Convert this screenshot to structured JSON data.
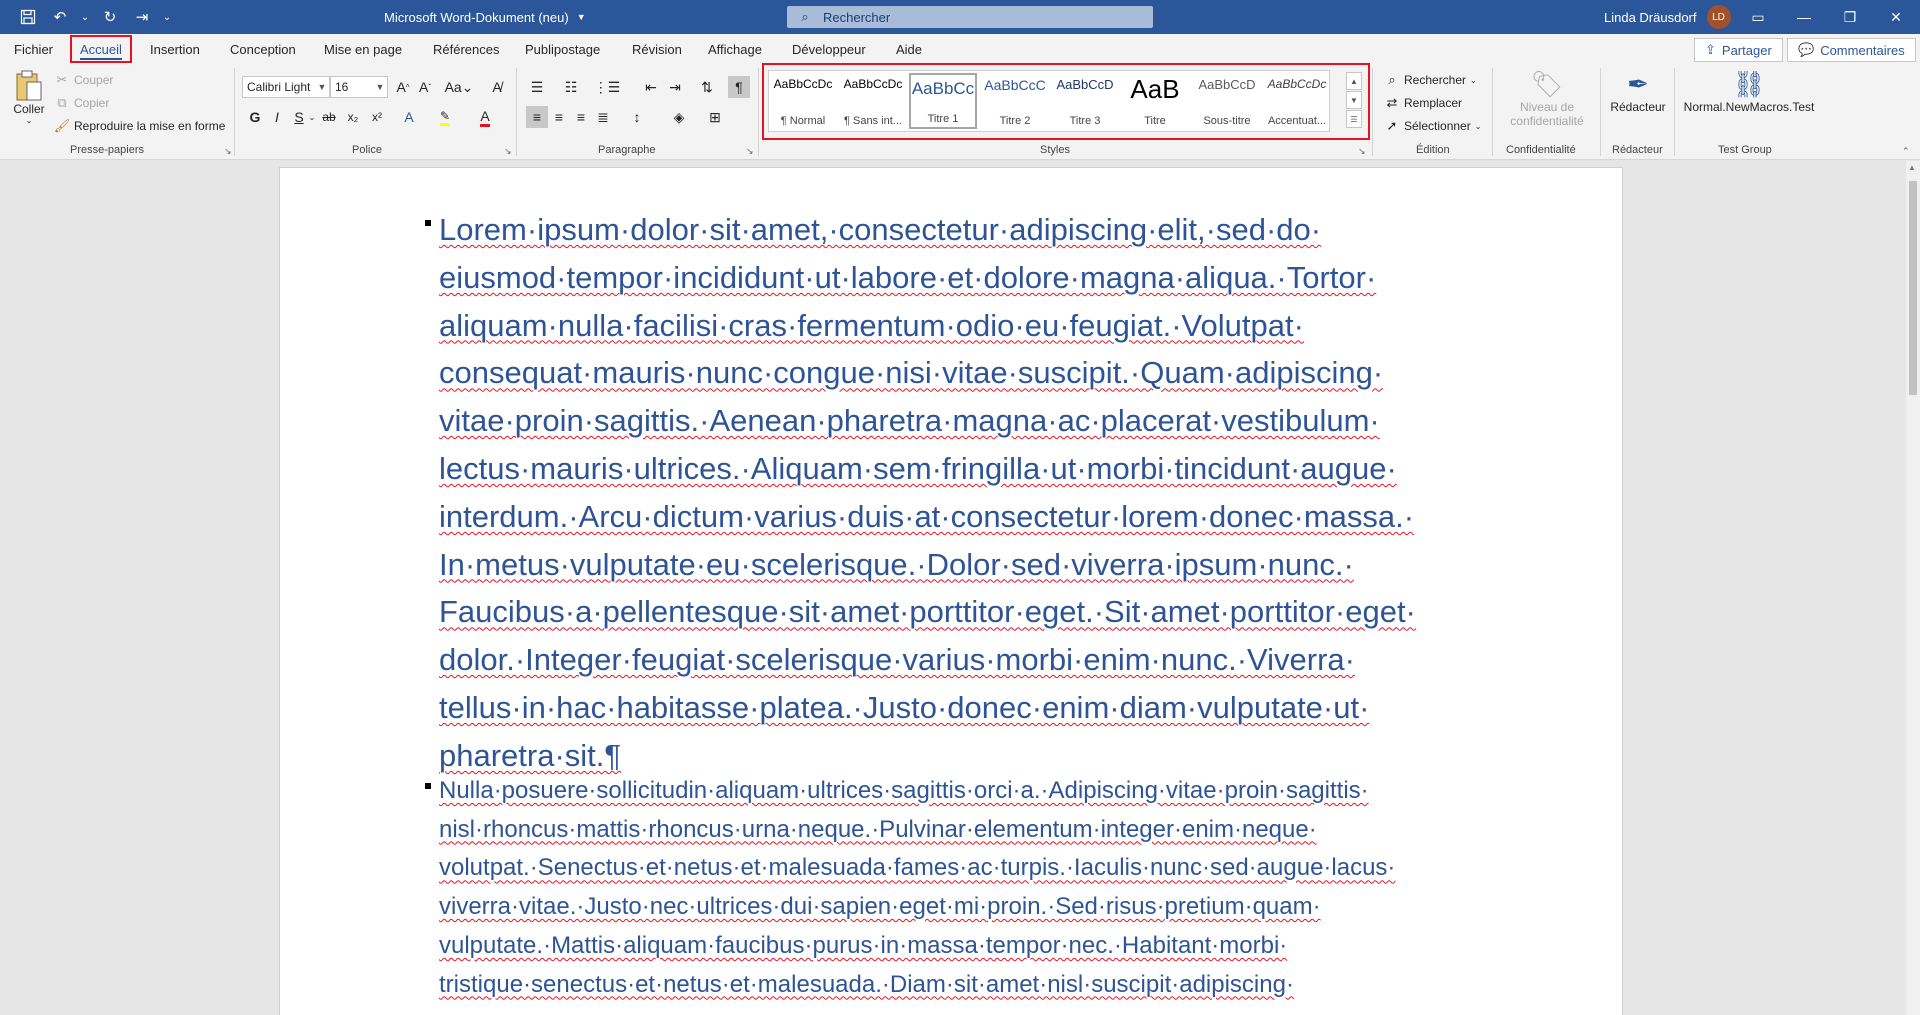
{
  "titlebar": {
    "doc_title": "Microsoft Word-Dokument (neu)",
    "search_placeholder": "Rechercher",
    "user_name": "Linda Dräusdorf",
    "user_initials": "LD"
  },
  "tabs": [
    "Fichier",
    "Accueil",
    "Insertion",
    "Conception",
    "Mise en page",
    "Références",
    "Publipostage",
    "Révision",
    "Affichage",
    "Développeur",
    "Aide"
  ],
  "active_tab": "Accueil",
  "share": {
    "partager": "Partager",
    "commentaires": "Commentaires"
  },
  "clipboard": {
    "label": "Presse-papiers",
    "coller": "Coller",
    "couper": "Couper",
    "copier": "Copier",
    "reproduire": "Reproduire la mise en forme"
  },
  "font": {
    "label": "Police",
    "family": "Calibri Light",
    "size": "16"
  },
  "paragraph": {
    "label": "Paragraphe"
  },
  "styles": {
    "label": "Styles",
    "items": [
      {
        "preview": "AaBbCcDc",
        "name": "¶ Normal"
      },
      {
        "preview": "AaBbCcDc",
        "name": "¶ Sans int..."
      },
      {
        "preview": "AaBbCc",
        "name": "Titre 1"
      },
      {
        "preview": "AaBbCcC",
        "name": "Titre 2"
      },
      {
        "preview": "AaBbCcD",
        "name": "Titre 3"
      },
      {
        "preview": "AaB",
        "name": "Titre"
      },
      {
        "preview": "AaBbCcD",
        "name": "Sous-titre"
      },
      {
        "preview": "AaBbCcDc",
        "name": "Accentuat..."
      }
    ],
    "selected_index": 2
  },
  "edition": {
    "label": "Édition",
    "rechercher": "Rechercher",
    "remplacer": "Remplacer",
    "selectionner": "Sélectionner"
  },
  "confidentialite": {
    "label": "Confidentialité",
    "niveau_line1": "Niveau de",
    "niveau_line2": "confidentialité"
  },
  "redacteur": {
    "label": "Rédacteur",
    "button": "Rédacteur"
  },
  "testgroup": {
    "label": "Test Group",
    "button": "Normal.NewMacros.Test"
  },
  "document": {
    "para1": "Lorem·ipsum·dolor·sit·amet,·consectetur·adipiscing·elit,·sed·do· eiusmod·tempor·incididunt·ut·labore·et·dolore·magna·aliqua.·Tortor· aliquam·nulla·facilisi·cras·fermentum·odio·eu·feugiat.·Volutpat· consequat·mauris·nunc·congue·nisi·vitae·suscipit.·Quam·adipiscing· vitae·proin·sagittis.·Aenean·pharetra·magna·ac·placerat·vestibulum· lectus·mauris·ultrices.·Aliquam·sem·fringilla·ut·morbi·tincidunt·augue· interdum.·Arcu·dictum·varius·duis·at·consectetur·lorem·donec·massa.· In·metus·vulputate·eu·scelerisque.·Dolor·sed·viverra·ipsum·nunc.· Faucibus·a·pellentesque·sit·amet·porttitor·eget.·Sit·amet·porttitor·eget· dolor.·Integer·feugiat·scelerisque·varius·morbi·enim·nunc.·Viverra· tellus·in·hac·habitasse·platea.·Justo·donec·enim·diam·vulputate·ut· pharetra·sit.¶",
    "para2": "Nulla·posuere·sollicitudin·aliquam·ultrices·sagittis·orci·a.·Adipiscing·vitae·proin·sagittis· nisl·rhoncus·mattis·rhoncus·urna·neque.·Pulvinar·elementum·integer·enim·neque· volutpat.·Senectus·et·netus·et·malesuada·fames·ac·turpis.·Iaculis·nunc·sed·augue·lacus· viverra·vitae.·Justo·nec·ultrices·dui·sapien·eget·mi·proin.·Sed·risus·pretium·quam· vulputate.·Mattis·aliquam·faucibus·purus·in·massa·tempor·nec.·Habitant·morbi· tristique·senectus·et·netus·et·malesuada.·Diam·sit·amet·nisl·suscipit·adipiscing·"
  },
  "colors": {
    "brand_blue": "#2b579a",
    "heading_text": "#2f5496",
    "highlight_red": "#e81123"
  }
}
